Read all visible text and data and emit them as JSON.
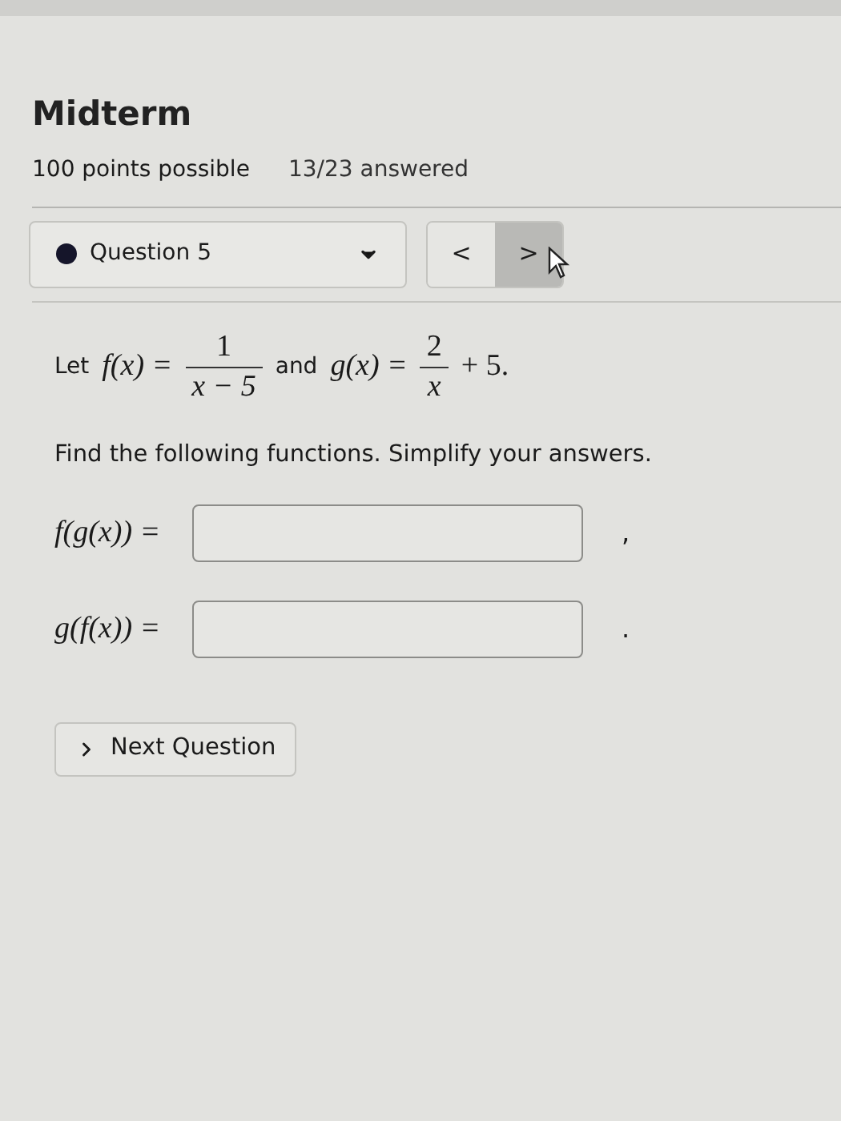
{
  "title": "Midterm",
  "points": "100 points possible",
  "progress": "13/23 answered",
  "question_select": {
    "label": "Question 5"
  },
  "nav_buttons": [
    {
      "label": "<",
      "hovered": false
    },
    {
      "label": ">",
      "hovered": true
    }
  ],
  "problem": {
    "intro": "Let",
    "f_def": "f(x) =",
    "f_num": "1",
    "f_den": "x − 5",
    "joiner": "and",
    "g_def": "g(x) =",
    "g_num": "2",
    "g_den": "x",
    "g_tail": "+ 5."
  },
  "instruction": "Find the following functions. Simplify your answers.",
  "answers": [
    {
      "label": "f(g(x)) =",
      "trailing": ","
    },
    {
      "label": "g(f(x)) =",
      "trailing": "."
    }
  ],
  "next_button": "Next Question"
}
